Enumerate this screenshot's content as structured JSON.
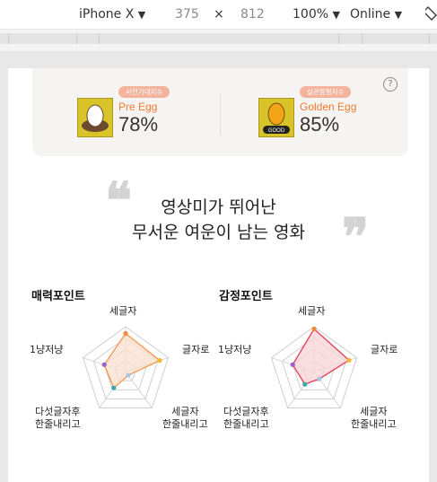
{
  "devtools": {
    "device": "iPhone X",
    "width": "375",
    "times": "×",
    "height": "812",
    "zoom": "100%",
    "network": "Online",
    "caret": "▼"
  },
  "eggs": {
    "help": "?",
    "pre": {
      "badge": "사전기대지수",
      "name": "Pre Egg",
      "value": "78%"
    },
    "golden": {
      "badge": "실관람평지수",
      "name": "Golden Egg",
      "value": "85%",
      "tag": "GOOD"
    }
  },
  "quote": {
    "open": "❝",
    "close": "❞",
    "line1": "영상미가 뛰어난",
    "line2": "무서운 여운이 남는 영화"
  },
  "charm": {
    "title": "매력포인트",
    "labels": {
      "top": "세글자",
      "right": "글자로",
      "bottom_right_1": "세글자",
      "bottom_right_2": "한줄내리고",
      "bottom_left_1": "다섯글자후",
      "bottom_left_2": "한줄내리고",
      "left": "1냥저냥"
    },
    "values": [
      0.85,
      0.8,
      0.1,
      0.45,
      0.5
    ],
    "color": "#f39a5a",
    "fill": "#fbe0cd"
  },
  "emotion": {
    "title": "감정포인트",
    "labels": {
      "top": "세글자",
      "right": "글자로",
      "bottom_right_1": "세글자",
      "bottom_right_2": "한줄내리고",
      "bottom_left_1": "다섯글자후",
      "bottom_left_2": "한줄내리고",
      "left": "1냥저냥"
    },
    "values": [
      0.95,
      0.82,
      0.2,
      0.35,
      0.5
    ],
    "color": "#e8445a",
    "fill": "#f8d3d6"
  },
  "point_colors": [
    "#f08a3a",
    "#f5b82e",
    "#a7c4e8",
    "#3aa8a8",
    "#9a62c8"
  ]
}
